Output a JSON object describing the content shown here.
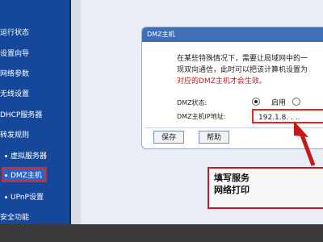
{
  "sidebar": {
    "items": [
      {
        "label": "运行状态"
      },
      {
        "label": "设置向导"
      },
      {
        "label": "网络参数"
      },
      {
        "label": "无线设置"
      },
      {
        "label": "DHCP服务器"
      },
      {
        "label": "转发规则"
      },
      {
        "label": "虚拟服务器"
      },
      {
        "label": "DMZ主机"
      },
      {
        "label": "UPnP设置"
      },
      {
        "label": "安全功能"
      }
    ]
  },
  "panel": {
    "title": "DMZ主机",
    "desc_line1": "在某些特殊情况下，需要让局域网中的一",
    "desc_line2": "现双向通信，此时可以把该计算机设置为",
    "desc_line3": "对应的DMZ主机才会生效。",
    "status_label": "DMZ状态:",
    "enable_label": "启用",
    "ip_label": "DMZ主机IP地址:",
    "ip_value": "192.1.8. . ..",
    "save_label": "保存",
    "help_label": "帮助"
  },
  "callout": {
    "line1": "填写服务",
    "line2": "网络打印"
  },
  "colors": {
    "sidebar_bg": "#15489a",
    "highlight_red": "#e8231f",
    "panel_header": "#3f6fb7",
    "warning_text": "#c4171b"
  }
}
